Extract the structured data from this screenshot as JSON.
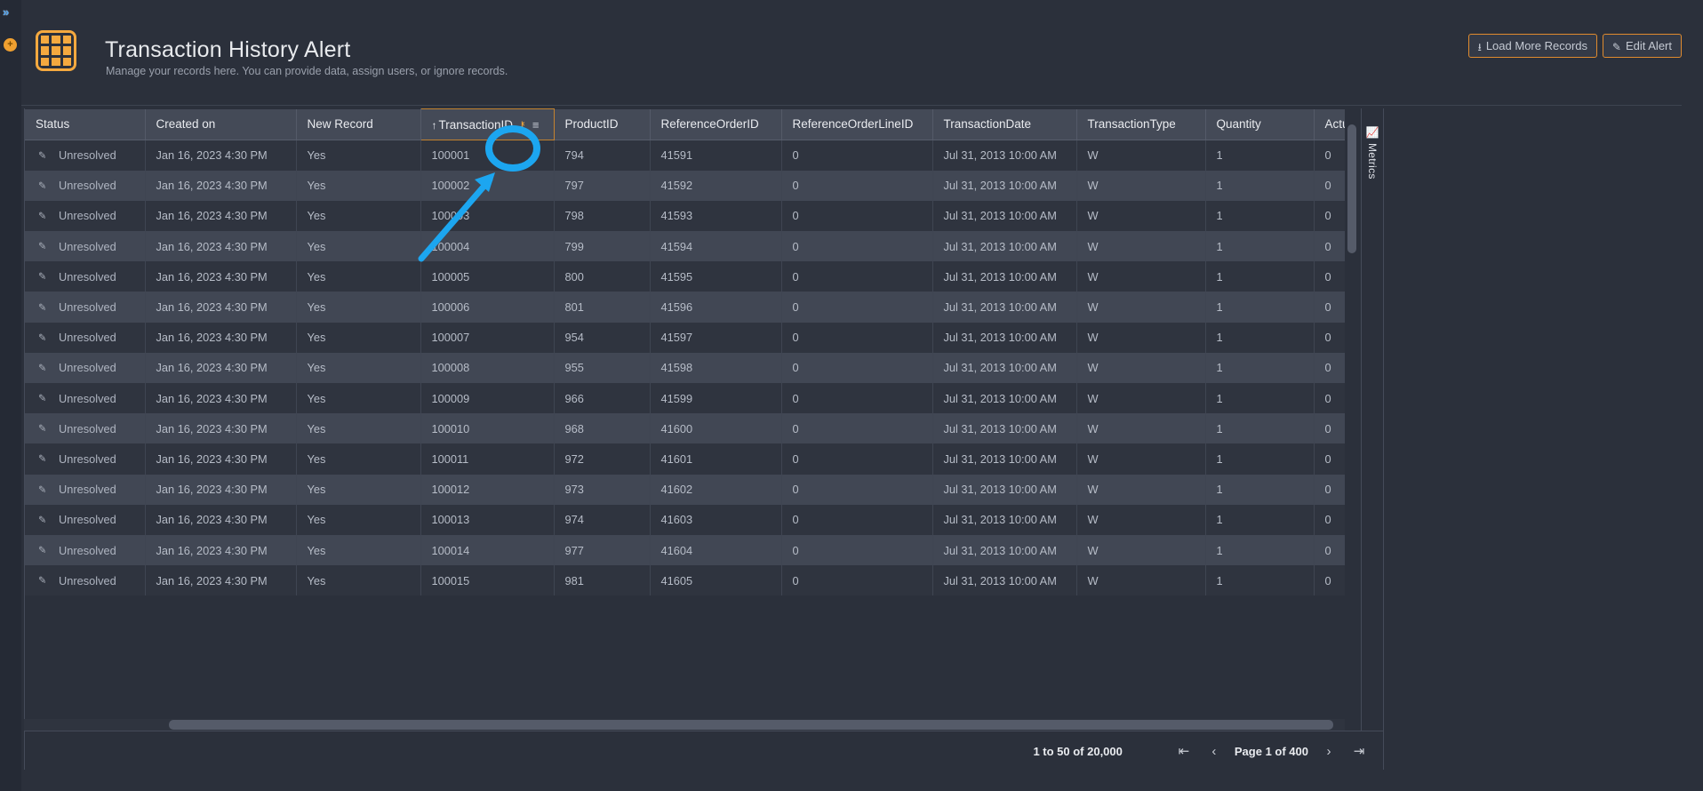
{
  "rail": {
    "expand_icon": "expand-chevrons-icon",
    "expand_glyph": "»",
    "add_icon": "add-circle-icon",
    "add_glyph": "⨁"
  },
  "header": {
    "app_icon": "grid-table-icon",
    "title": "Transaction History Alert",
    "subtitle": "Manage your records here. You can provide data, assign users, or ignore records.",
    "buttons": [
      {
        "id": "load-more-records",
        "label": "Load More Records",
        "icon": "download-circle-icon",
        "glyph": "⭳"
      },
      {
        "id": "edit-alert",
        "label": "Edit Alert",
        "icon": "edit-square-icon",
        "glyph": "✎"
      }
    ]
  },
  "grid": {
    "columns": [
      {
        "key": "status",
        "label": "Status",
        "sorted": false
      },
      {
        "key": "created",
        "label": "Created on",
        "sorted": false
      },
      {
        "key": "new_record",
        "label": "New Record",
        "sorted": false
      },
      {
        "key": "transaction_id",
        "label": "TransactionID",
        "sorted": true,
        "sort_dir": "asc",
        "sort_glyph": "↑",
        "key_icon": "key-icon",
        "key_glyph": "⚷",
        "menu_icon": "hamburger-menu-icon",
        "menu_glyph": "≡"
      },
      {
        "key": "product_id",
        "label": "ProductID",
        "sorted": false
      },
      {
        "key": "reference_order_id",
        "label": "ReferenceOrderID",
        "sorted": false
      },
      {
        "key": "reference_order_line_id",
        "label": "ReferenceOrderLineID",
        "sorted": false
      },
      {
        "key": "transaction_date",
        "label": "TransactionDate",
        "sorted": false
      },
      {
        "key": "transaction_type",
        "label": "TransactionType",
        "sorted": false
      },
      {
        "key": "quantity",
        "label": "Quantity",
        "sorted": false
      },
      {
        "key": "actual_cost",
        "label": "ActualCost",
        "sorted": false
      }
    ],
    "row_edit_icon": "pencil-edit-icon",
    "row_edit_glyph": "✎",
    "rows": [
      {
        "status": "Unresolved",
        "created": "Jan 16, 2023 4:30 PM",
        "new_record": "Yes",
        "transaction_id": "100001",
        "product_id": "794",
        "reference_order_id": "41591",
        "reference_order_line_id": "0",
        "transaction_date": "Jul 31, 2013 10:00 AM",
        "transaction_type": "W",
        "quantity": "1",
        "actual_cost": "0"
      },
      {
        "status": "Unresolved",
        "created": "Jan 16, 2023 4:30 PM",
        "new_record": "Yes",
        "transaction_id": "100002",
        "product_id": "797",
        "reference_order_id": "41592",
        "reference_order_line_id": "0",
        "transaction_date": "Jul 31, 2013 10:00 AM",
        "transaction_type": "W",
        "quantity": "1",
        "actual_cost": "0"
      },
      {
        "status": "Unresolved",
        "created": "Jan 16, 2023 4:30 PM",
        "new_record": "Yes",
        "transaction_id": "100003",
        "product_id": "798",
        "reference_order_id": "41593",
        "reference_order_line_id": "0",
        "transaction_date": "Jul 31, 2013 10:00 AM",
        "transaction_type": "W",
        "quantity": "1",
        "actual_cost": "0"
      },
      {
        "status": "Unresolved",
        "created": "Jan 16, 2023 4:30 PM",
        "new_record": "Yes",
        "transaction_id": "100004",
        "product_id": "799",
        "reference_order_id": "41594",
        "reference_order_line_id": "0",
        "transaction_date": "Jul 31, 2013 10:00 AM",
        "transaction_type": "W",
        "quantity": "1",
        "actual_cost": "0"
      },
      {
        "status": "Unresolved",
        "created": "Jan 16, 2023 4:30 PM",
        "new_record": "Yes",
        "transaction_id": "100005",
        "product_id": "800",
        "reference_order_id": "41595",
        "reference_order_line_id": "0",
        "transaction_date": "Jul 31, 2013 10:00 AM",
        "transaction_type": "W",
        "quantity": "1",
        "actual_cost": "0"
      },
      {
        "status": "Unresolved",
        "created": "Jan 16, 2023 4:30 PM",
        "new_record": "Yes",
        "transaction_id": "100006",
        "product_id": "801",
        "reference_order_id": "41596",
        "reference_order_line_id": "0",
        "transaction_date": "Jul 31, 2013 10:00 AM",
        "transaction_type": "W",
        "quantity": "1",
        "actual_cost": "0"
      },
      {
        "status": "Unresolved",
        "created": "Jan 16, 2023 4:30 PM",
        "new_record": "Yes",
        "transaction_id": "100007",
        "product_id": "954",
        "reference_order_id": "41597",
        "reference_order_line_id": "0",
        "transaction_date": "Jul 31, 2013 10:00 AM",
        "transaction_type": "W",
        "quantity": "1",
        "actual_cost": "0"
      },
      {
        "status": "Unresolved",
        "created": "Jan 16, 2023 4:30 PM",
        "new_record": "Yes",
        "transaction_id": "100008",
        "product_id": "955",
        "reference_order_id": "41598",
        "reference_order_line_id": "0",
        "transaction_date": "Jul 31, 2013 10:00 AM",
        "transaction_type": "W",
        "quantity": "1",
        "actual_cost": "0"
      },
      {
        "status": "Unresolved",
        "created": "Jan 16, 2023 4:30 PM",
        "new_record": "Yes",
        "transaction_id": "100009",
        "product_id": "966",
        "reference_order_id": "41599",
        "reference_order_line_id": "0",
        "transaction_date": "Jul 31, 2013 10:00 AM",
        "transaction_type": "W",
        "quantity": "1",
        "actual_cost": "0"
      },
      {
        "status": "Unresolved",
        "created": "Jan 16, 2023 4:30 PM",
        "new_record": "Yes",
        "transaction_id": "100010",
        "product_id": "968",
        "reference_order_id": "41600",
        "reference_order_line_id": "0",
        "transaction_date": "Jul 31, 2013 10:00 AM",
        "transaction_type": "W",
        "quantity": "1",
        "actual_cost": "0"
      },
      {
        "status": "Unresolved",
        "created": "Jan 16, 2023 4:30 PM",
        "new_record": "Yes",
        "transaction_id": "100011",
        "product_id": "972",
        "reference_order_id": "41601",
        "reference_order_line_id": "0",
        "transaction_date": "Jul 31, 2013 10:00 AM",
        "transaction_type": "W",
        "quantity": "1",
        "actual_cost": "0"
      },
      {
        "status": "Unresolved",
        "created": "Jan 16, 2023 4:30 PM",
        "new_record": "Yes",
        "transaction_id": "100012",
        "product_id": "973",
        "reference_order_id": "41602",
        "reference_order_line_id": "0",
        "transaction_date": "Jul 31, 2013 10:00 AM",
        "transaction_type": "W",
        "quantity": "1",
        "actual_cost": "0"
      },
      {
        "status": "Unresolved",
        "created": "Jan 16, 2023 4:30 PM",
        "new_record": "Yes",
        "transaction_id": "100013",
        "product_id": "974",
        "reference_order_id": "41603",
        "reference_order_line_id": "0",
        "transaction_date": "Jul 31, 2013 10:00 AM",
        "transaction_type": "W",
        "quantity": "1",
        "actual_cost": "0"
      },
      {
        "status": "Unresolved",
        "created": "Jan 16, 2023 4:30 PM",
        "new_record": "Yes",
        "transaction_id": "100014",
        "product_id": "977",
        "reference_order_id": "41604",
        "reference_order_line_id": "0",
        "transaction_date": "Jul 31, 2013 10:00 AM",
        "transaction_type": "W",
        "quantity": "1",
        "actual_cost": "0"
      },
      {
        "status": "Unresolved",
        "created": "Jan 16, 2023 4:30 PM",
        "new_record": "Yes",
        "transaction_id": "100015",
        "product_id": "981",
        "reference_order_id": "41605",
        "reference_order_line_id": "0",
        "transaction_date": "Jul 31, 2013 10:00 AM",
        "transaction_type": "W",
        "quantity": "1",
        "actual_cost": "0"
      }
    ]
  },
  "metrics_tab": {
    "label": "Metrics",
    "icon": "line-chart-icon",
    "glyph": "📈"
  },
  "pagination": {
    "row_range": "1 to 50 of 20,000",
    "page_label": "Page 1 of 400",
    "first_glyph": "⇤",
    "prev_glyph": "‹",
    "next_glyph": "›",
    "last_glyph": "⇥"
  },
  "annotation": {
    "shape": "blue-oval-highlight-with-arrow",
    "target": "transaction-id-sort-arrow",
    "color": "#1ca6f0"
  },
  "colors": {
    "accent_orange": "#f5a93f",
    "annotation_blue": "#1ca6f0",
    "panel_bg": "#2b303b",
    "header_row_bg": "#444a57",
    "row_odd_bg": "#2f343f",
    "row_even_bg": "#414754"
  }
}
